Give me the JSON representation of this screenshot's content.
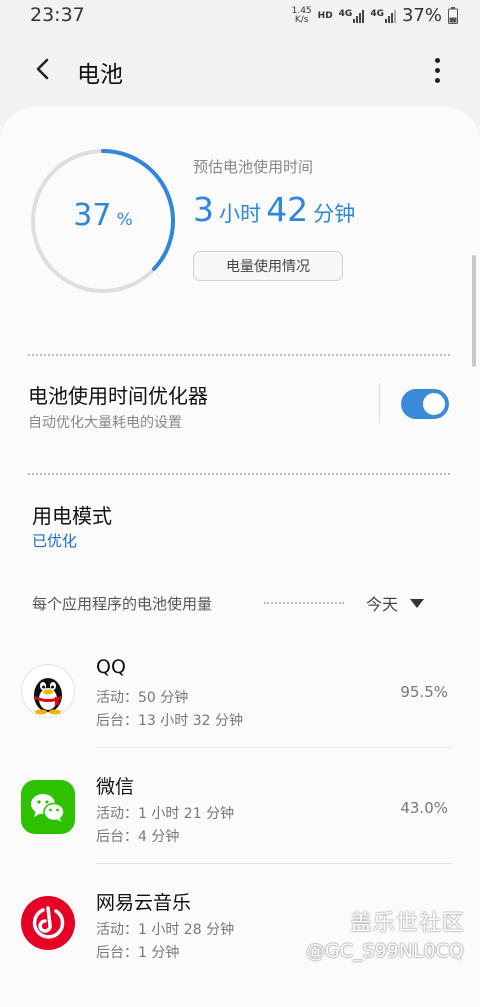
{
  "status_bar": {
    "time": "23:37",
    "net_speed_top": "1.45",
    "net_speed_unit": "K/s",
    "hd_label": "HD",
    "sim1_net": "4G",
    "sim2_net": "4G",
    "battery": "37%"
  },
  "header": {
    "title": "电池"
  },
  "summary": {
    "percent_value": "37",
    "percent_unit": "%",
    "level": 0.37,
    "estimate_label": "预估电池使用时间",
    "hours": "3",
    "hours_unit": "小时",
    "minutes": "42",
    "minutes_unit": "分钟",
    "usage_button": "电量使用情况"
  },
  "optimizer": {
    "title": "电池使用时间优化器",
    "subtitle": "自动优化大量耗电的设置",
    "enabled": true
  },
  "power_mode": {
    "title": "用电模式",
    "status": "已优化"
  },
  "apps_section": {
    "header": "每个应用程序的电池使用量",
    "period": "今天"
  },
  "apps": [
    {
      "name": "QQ",
      "active": "活动：50 分钟",
      "background": "后台：13 小时 32 分钟",
      "percent": "95.5%"
    },
    {
      "name": "微信",
      "active": "活动：1 小时 21 分钟",
      "background": "后台：4 分钟",
      "percent": "43.0%"
    },
    {
      "name": "网易云音乐",
      "active": "活动：1 小时 28 分钟",
      "background": "后台：1 分钟",
      "percent": ""
    }
  ],
  "watermark": {
    "title": "盖乐世社区",
    "handle": "@GC_S99NL0CQ"
  },
  "colors": {
    "accent": "#2e86de",
    "toggle_on": "#3a8cd9",
    "wechat": "#2dc100",
    "netease": "#e60026"
  }
}
